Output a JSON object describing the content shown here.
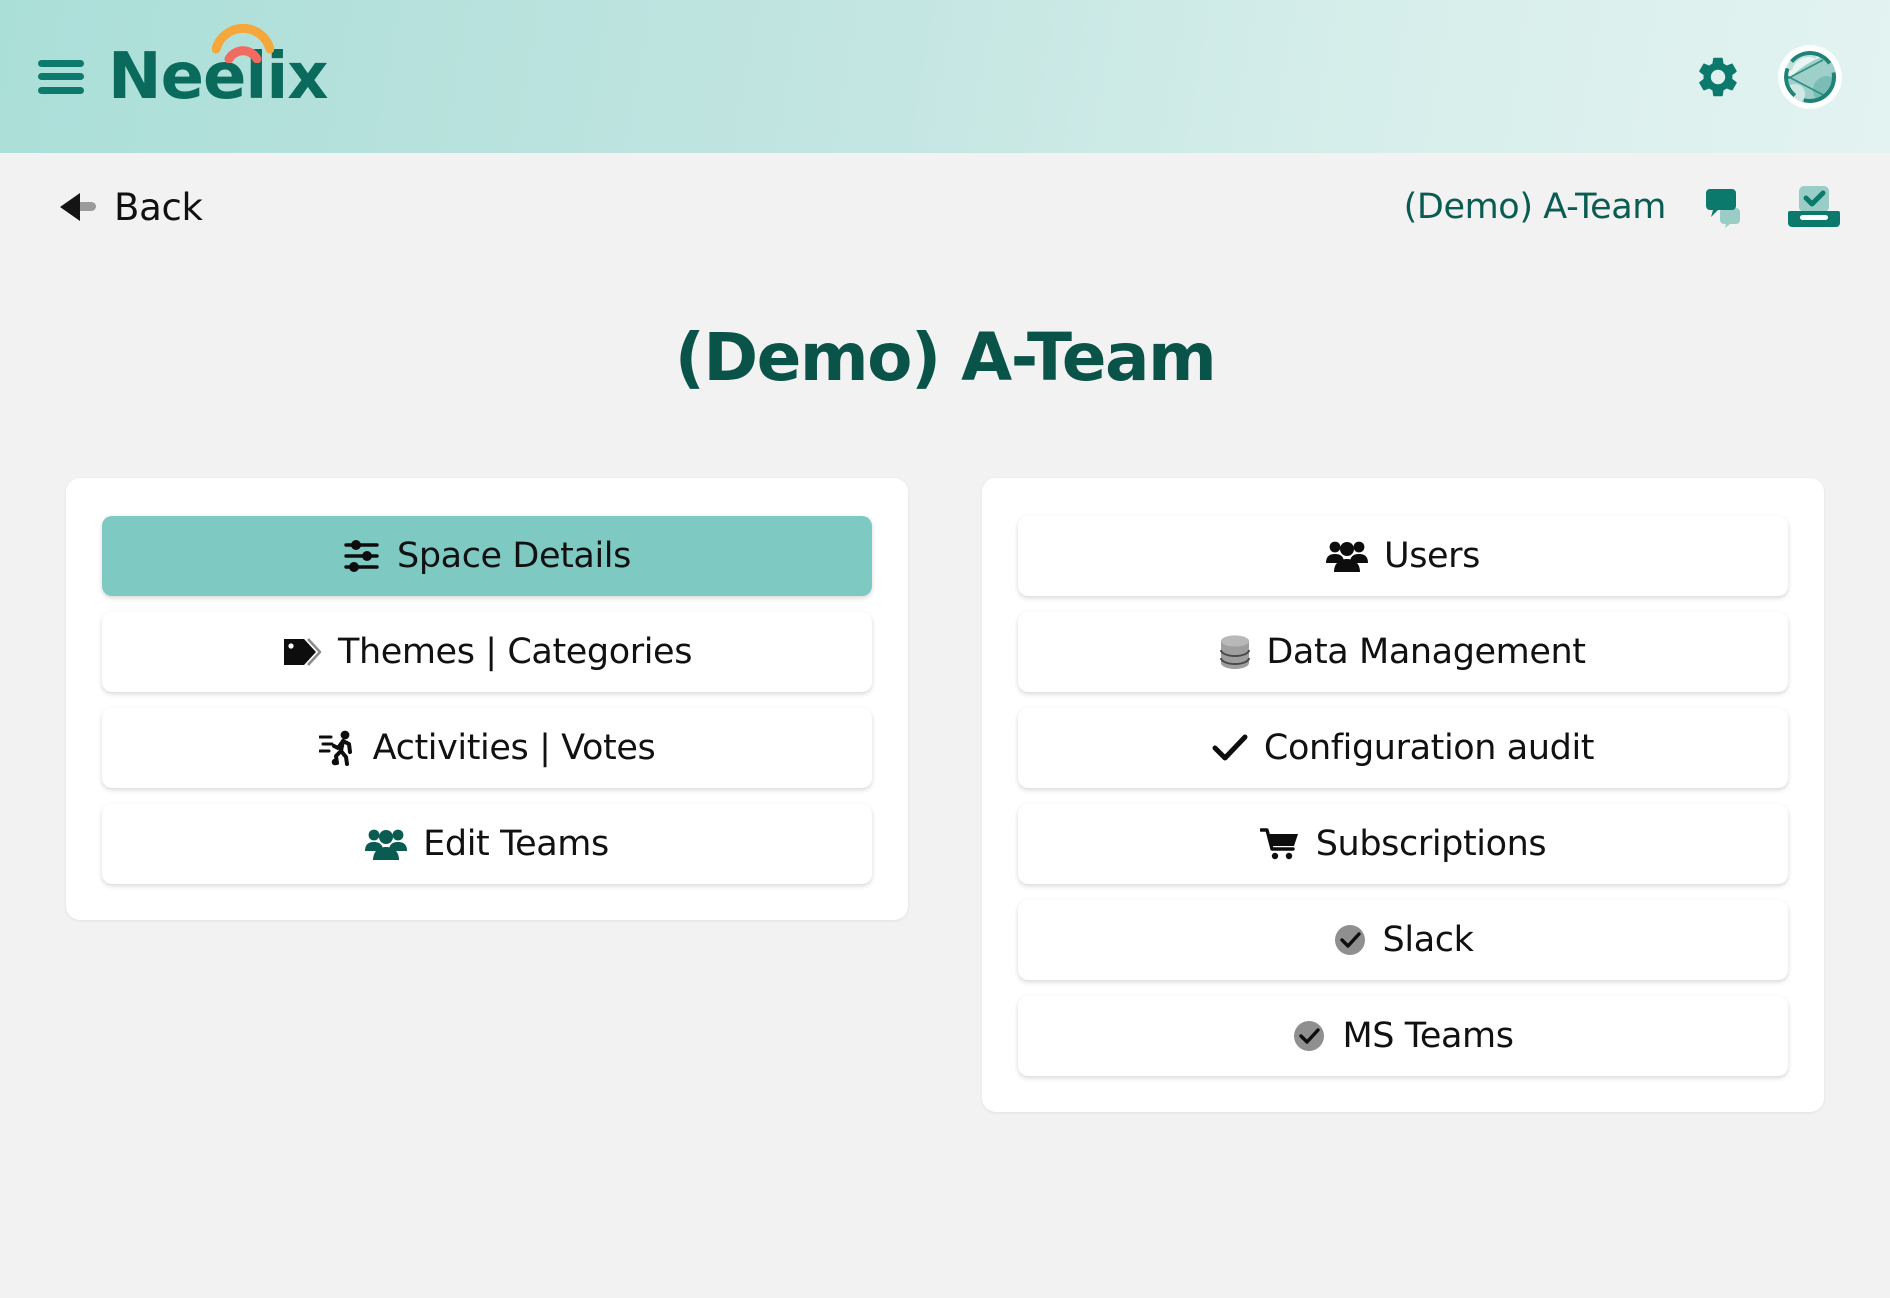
{
  "header": {
    "menu_icon": "hamburger-icon",
    "logo_text": "Neelix",
    "logo_arc_outer_color": "#f5a73c",
    "logo_arc_inner_color": "#f26b61",
    "logo_color": "#0a6b5c",
    "settings_icon": "gear-icon",
    "avatar_icon": "user-avatar",
    "gradient_from": "#aadfd8",
    "gradient_to": "#e3f3f1"
  },
  "subbar": {
    "back_label": "Back",
    "back_icon": "back-arrow-icon",
    "space_name": "(Demo) A-Team",
    "chat_icon": "chat-bubbles-icon",
    "inbox_icon": "inbox-check-icon"
  },
  "page": {
    "title": "(Demo) A-Team",
    "title_color": "#0a5348",
    "background": "#f2f2f2"
  },
  "left_card": {
    "items": [
      {
        "label": "Space Details",
        "icon": "sliders-icon",
        "active": true
      },
      {
        "label": "Themes | Categories",
        "icon": "tag-icon",
        "active": false
      },
      {
        "label": "Activities | Votes",
        "icon": "running-icon",
        "active": false
      },
      {
        "label": "Edit Teams",
        "icon": "users-group-icon",
        "active": false
      }
    ],
    "active_color": "#7ecac3"
  },
  "right_card": {
    "items": [
      {
        "label": "Users",
        "icon": "users-group-icon",
        "active": false
      },
      {
        "label": "Data Management",
        "icon": "database-icon",
        "active": false
      },
      {
        "label": "Configuration audit",
        "icon": "check-icon",
        "active": false
      },
      {
        "label": "Subscriptions",
        "icon": "shopping-cart-icon",
        "active": false
      },
      {
        "label": "Slack",
        "icon": "check-circle-icon",
        "active": false
      },
      {
        "label": "MS Teams",
        "icon": "check-circle-icon",
        "active": false
      }
    ]
  }
}
